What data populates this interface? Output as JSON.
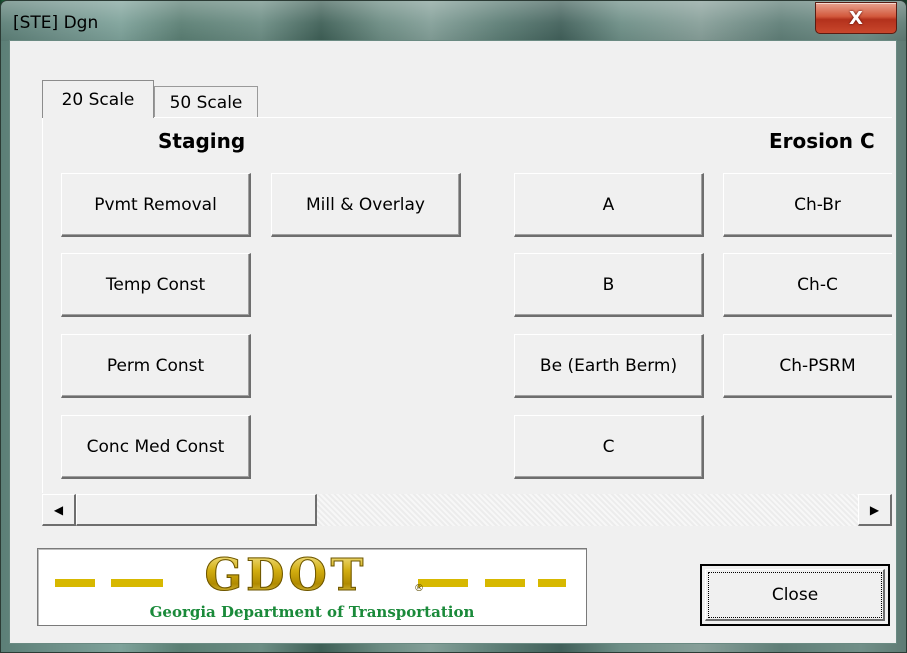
{
  "window": {
    "title": "[STE] Dgn",
    "close_glyph": "X"
  },
  "tabs": [
    {
      "label": "20 Scale",
      "active": true
    },
    {
      "label": "50 Scale",
      "active": false
    }
  ],
  "staging": {
    "heading": "Staging",
    "buttons": [
      "Pvmt Removal",
      "Mill & Overlay",
      "Temp Const",
      "Perm Const",
      "Conc Med Const"
    ]
  },
  "erosion": {
    "heading": "Erosion C",
    "buttons": [
      "A",
      "B",
      "Be (Earth Berm)",
      "C",
      "Ch-Br",
      "Ch-C",
      "Ch-PSRM"
    ]
  },
  "scrollbar": {
    "left_arrow": "◀",
    "right_arrow": "▶",
    "position": 0.0
  },
  "logo": {
    "wordmark": "GDOT",
    "registered": "®",
    "subtitle": "Georgia Department of Transportation",
    "colors": {
      "gold": "#d7b800",
      "green": "#1a8a3a"
    }
  },
  "footer": {
    "close_label": "Close"
  }
}
